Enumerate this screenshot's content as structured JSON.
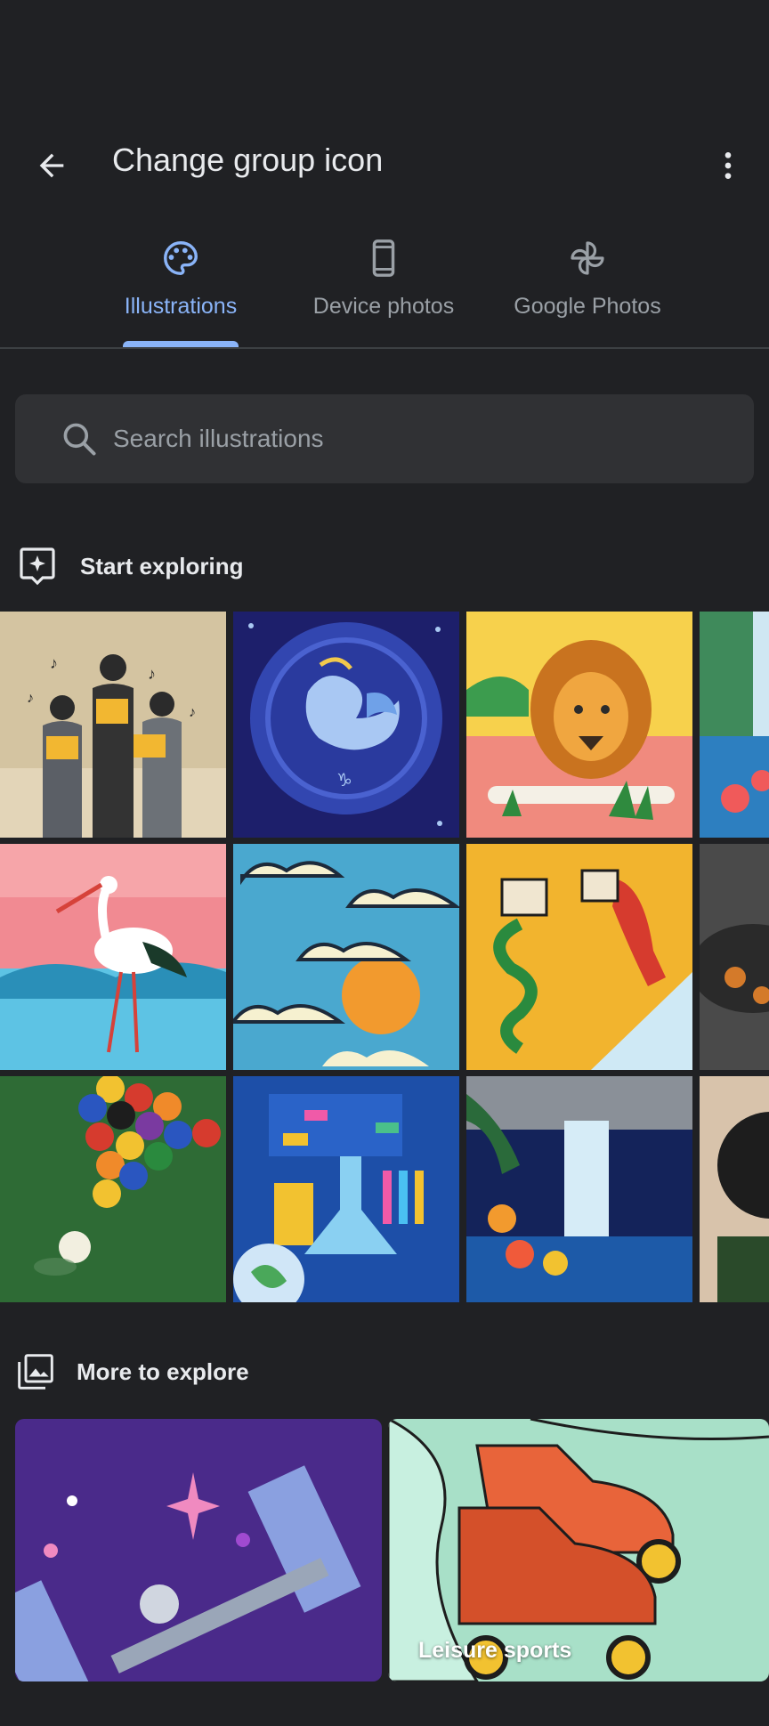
{
  "header": {
    "title": "Change group icon",
    "back_icon": "arrow-left-icon",
    "more_icon": "more-vert-icon"
  },
  "tabs": [
    {
      "label": "Illustrations",
      "icon": "palette-icon",
      "active": true
    },
    {
      "label": "Device photos",
      "icon": "smartphone-icon",
      "active": false
    },
    {
      "label": "Google Photos",
      "icon": "pinwheel-icon",
      "active": false
    }
  ],
  "search": {
    "placeholder": "Search illustrations",
    "value": ""
  },
  "sections": {
    "start_exploring": {
      "label": "Start exploring",
      "icon": "sparkle-box-icon"
    },
    "more_to_explore": {
      "label": "More to explore",
      "icon": "photo-library-icon"
    }
  },
  "explore_cards": [
    {
      "label": "",
      "illustration": "space-station"
    },
    {
      "label": "Leisure sports",
      "illustration": "roller-skates"
    }
  ],
  "colors": {
    "background": "#202124",
    "accent": "#8ab4f8",
    "surface": "#303134",
    "text_primary": "#e8eaed",
    "text_secondary": "#9aa0a6"
  }
}
